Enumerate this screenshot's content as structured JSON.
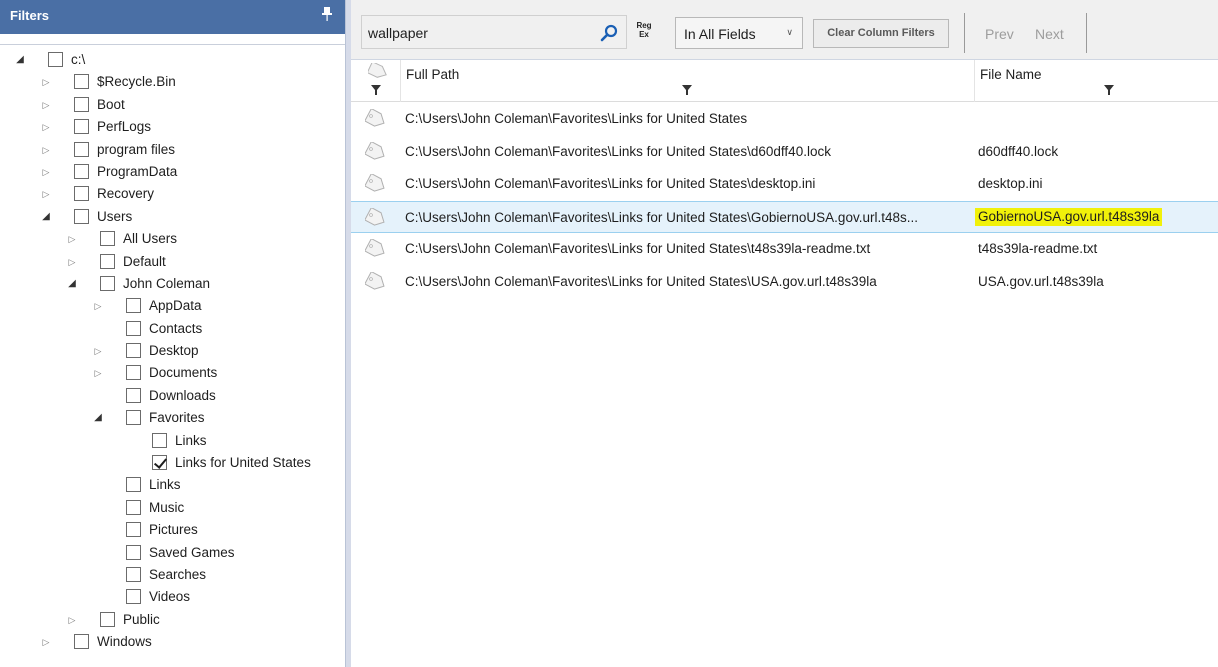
{
  "filters": {
    "title": "Filters",
    "tree": [
      {
        "label": "c:\\",
        "depth": 0,
        "expander": "open",
        "checked": false
      },
      {
        "label": "$Recycle.Bin",
        "depth": 1,
        "expander": "closed",
        "checked": false
      },
      {
        "label": "Boot",
        "depth": 1,
        "expander": "closed",
        "checked": false
      },
      {
        "label": "PerfLogs",
        "depth": 1,
        "expander": "closed",
        "checked": false
      },
      {
        "label": "program files",
        "depth": 1,
        "expander": "closed",
        "checked": false
      },
      {
        "label": "ProgramData",
        "depth": 1,
        "expander": "closed",
        "checked": false
      },
      {
        "label": "Recovery",
        "depth": 1,
        "expander": "closed",
        "checked": false
      },
      {
        "label": "Users",
        "depth": 1,
        "expander": "open",
        "checked": false
      },
      {
        "label": "All Users",
        "depth": 2,
        "expander": "closed",
        "checked": false
      },
      {
        "label": "Default",
        "depth": 2,
        "expander": "closed",
        "checked": false
      },
      {
        "label": "John Coleman",
        "depth": 2,
        "expander": "open",
        "checked": false
      },
      {
        "label": "AppData",
        "depth": 3,
        "expander": "closed",
        "checked": false
      },
      {
        "label": "Contacts",
        "depth": 3,
        "expander": "none",
        "checked": false
      },
      {
        "label": "Desktop",
        "depth": 3,
        "expander": "closed",
        "checked": false
      },
      {
        "label": "Documents",
        "depth": 3,
        "expander": "closed",
        "checked": false
      },
      {
        "label": "Downloads",
        "depth": 3,
        "expander": "none",
        "checked": false
      },
      {
        "label": "Favorites",
        "depth": 3,
        "expander": "open",
        "checked": false
      },
      {
        "label": "Links",
        "depth": 4,
        "expander": "none",
        "checked": false
      },
      {
        "label": "Links for United States",
        "depth": 4,
        "expander": "none",
        "checked": true
      },
      {
        "label": "Links",
        "depth": 3,
        "expander": "none",
        "checked": false
      },
      {
        "label": "Music",
        "depth": 3,
        "expander": "none",
        "checked": false
      },
      {
        "label": "Pictures",
        "depth": 3,
        "expander": "none",
        "checked": false
      },
      {
        "label": "Saved Games",
        "depth": 3,
        "expander": "none",
        "checked": false
      },
      {
        "label": "Searches",
        "depth": 3,
        "expander": "none",
        "checked": false
      },
      {
        "label": "Videos",
        "depth": 3,
        "expander": "none",
        "checked": false
      },
      {
        "label": "Public",
        "depth": 2,
        "expander": "closed",
        "checked": false
      },
      {
        "label": "Windows",
        "depth": 1,
        "expander": "closed",
        "checked": false
      }
    ]
  },
  "toolbar": {
    "search_value": "wallpaper",
    "regex_label_line1": "Reg",
    "regex_label_line2": "Ex",
    "field_select_value": "In All Fields",
    "clear_filters_label": "Clear Column Filters",
    "prev_label": "Prev",
    "next_label": "Next"
  },
  "grid": {
    "columns": {
      "full_path": "Full Path",
      "file_name": "File Name"
    },
    "rows": [
      {
        "path": "C:\\Users\\John Coleman\\Favorites\\Links for United States",
        "name": "",
        "selected": false,
        "highlight": false
      },
      {
        "path": "C:\\Users\\John Coleman\\Favorites\\Links for United States\\d60dff40.lock",
        "name": "d60dff40.lock",
        "selected": false,
        "highlight": false
      },
      {
        "path": "C:\\Users\\John Coleman\\Favorites\\Links for United States\\desktop.ini",
        "name": "desktop.ini",
        "selected": false,
        "highlight": false
      },
      {
        "path": "C:\\Users\\John Coleman\\Favorites\\Links for United States\\GobiernoUSA.gov.url.t48s...",
        "name": "GobiernoUSA.gov.url.t48s39la",
        "selected": true,
        "highlight": true
      },
      {
        "path": "C:\\Users\\John Coleman\\Favorites\\Links for United States\\t48s39la-readme.txt",
        "name": "t48s39la-readme.txt",
        "selected": false,
        "highlight": false
      },
      {
        "path": "C:\\Users\\John Coleman\\Favorites\\Links for United States\\USA.gov.url.t48s39la",
        "name": "USA.gov.url.t48s39la",
        "selected": false,
        "highlight": false
      }
    ]
  },
  "colors": {
    "filters_header": "#4a6fa5",
    "selected_row": "#e5f2fb",
    "search_highlight": "#f1f10a"
  }
}
